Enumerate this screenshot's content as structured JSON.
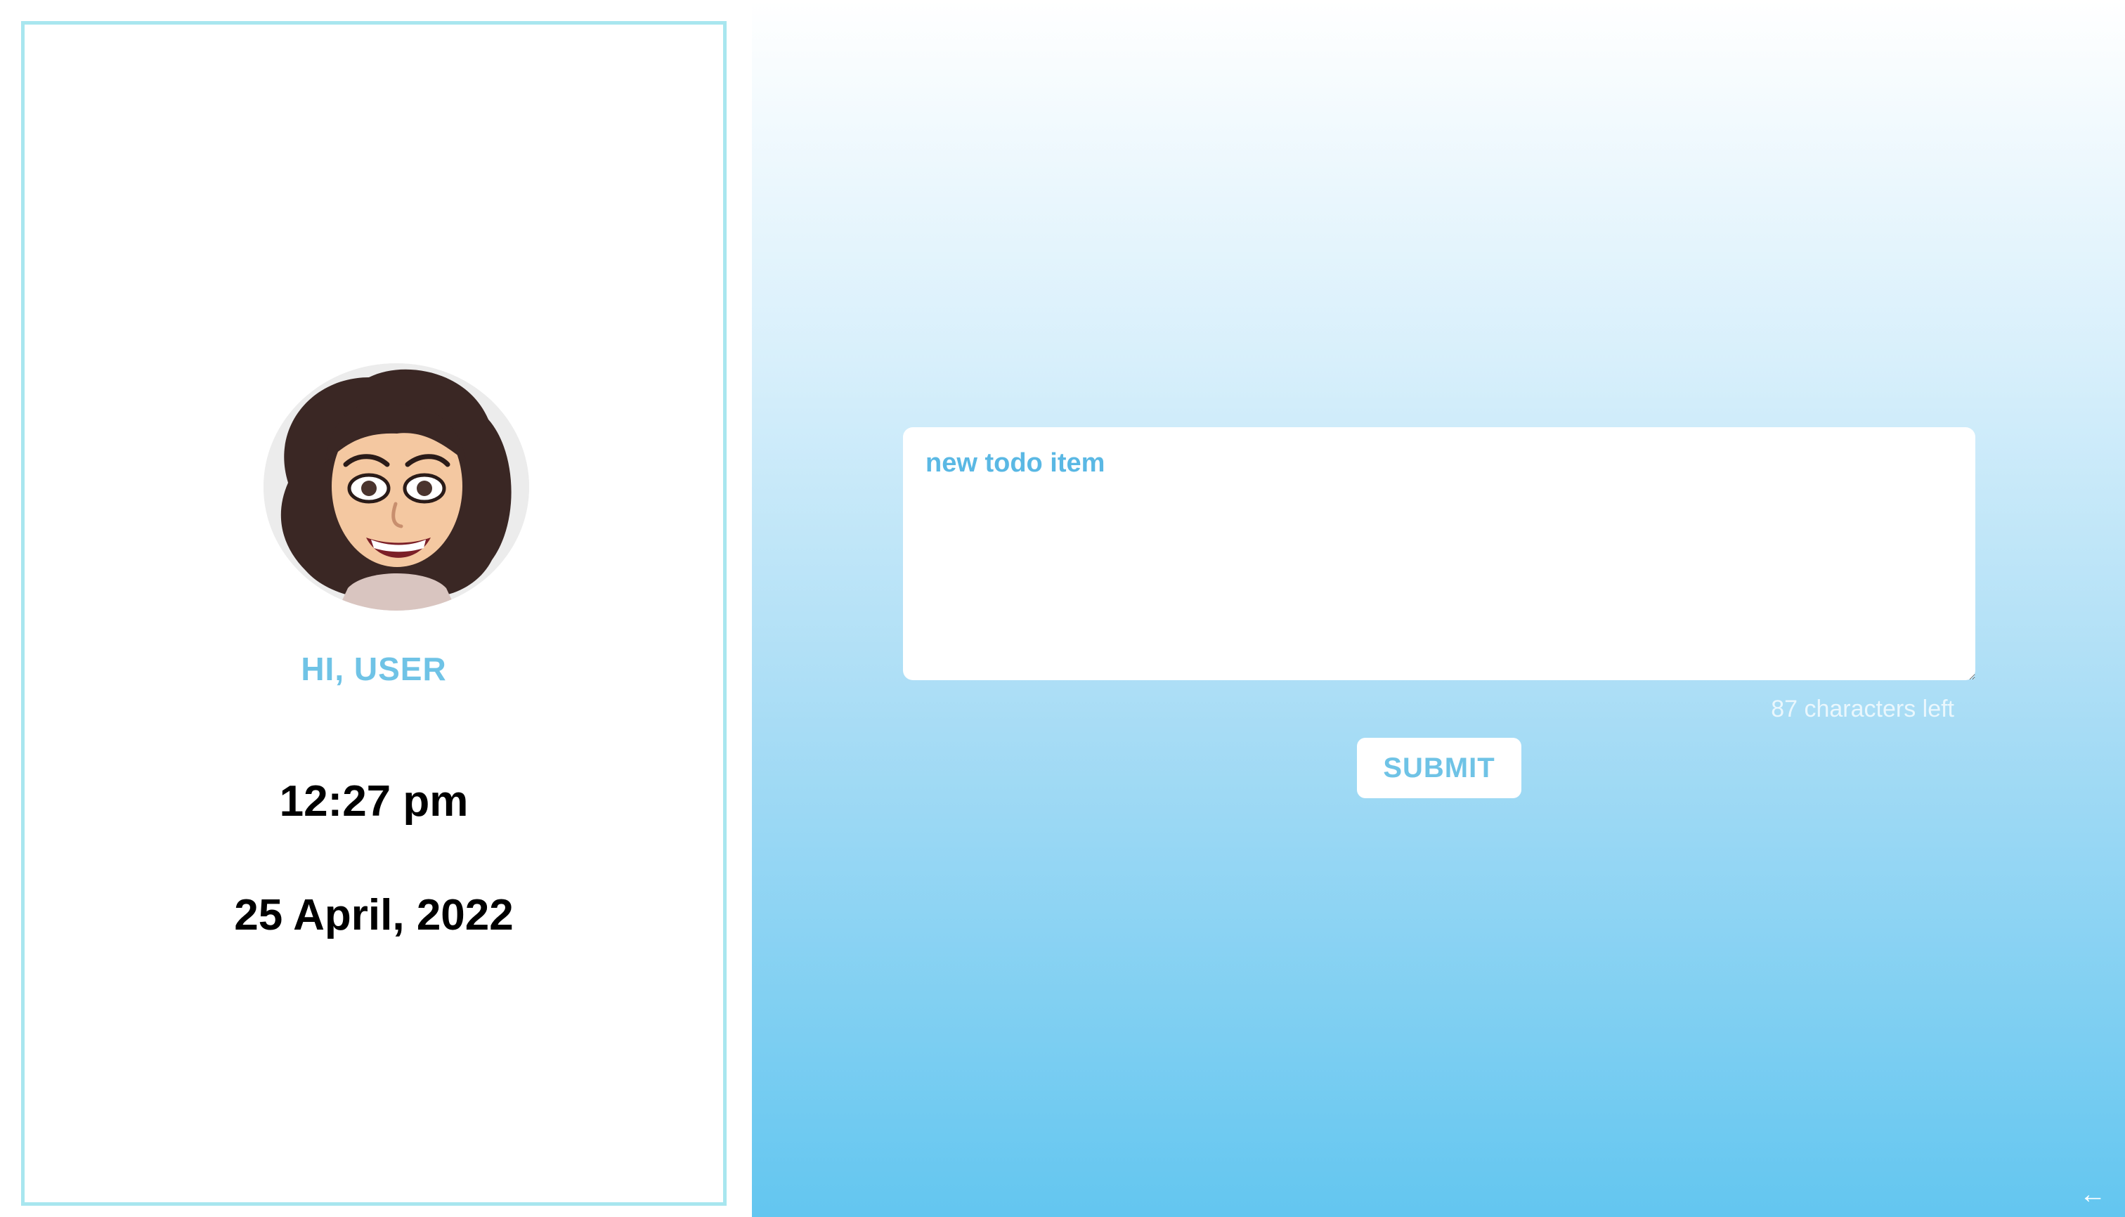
{
  "profile": {
    "greeting": "HI, USER",
    "time": "12:27 pm",
    "date": "25 April, 2022",
    "avatar_icon": "avatar-icon"
  },
  "todo": {
    "value": "new todo item",
    "chars_left": "87 characters left",
    "submit_label": "SUBMIT"
  },
  "nav": {
    "back_icon": "arrow-left-icon"
  },
  "colors": {
    "accent": "#6fc3e6",
    "border": "#a8e6ef",
    "gradient_bottom": "#63c6f0"
  }
}
